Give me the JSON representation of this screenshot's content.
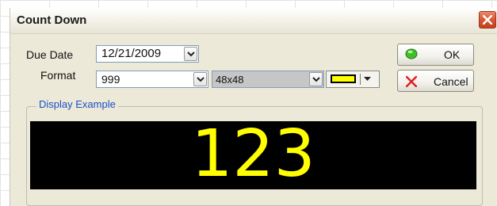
{
  "window": {
    "title": "Count Down"
  },
  "form": {
    "due_date_label": "Due Date",
    "due_date_value": "12/21/2009",
    "format_label": "Format",
    "format_value": "999",
    "size_value": "48x48",
    "color_value": "#ffff00"
  },
  "buttons": {
    "ok_label": "OK",
    "cancel_label": "Cancel"
  },
  "display": {
    "group_label": "Display Example",
    "example_text": "123",
    "text_color": "#ffff00",
    "background_color": "#000000"
  },
  "icons": {
    "close": "close-icon",
    "ok": "green-dot-icon",
    "cancel": "red-x-icon",
    "dropdown": "chevron-down-icon"
  }
}
